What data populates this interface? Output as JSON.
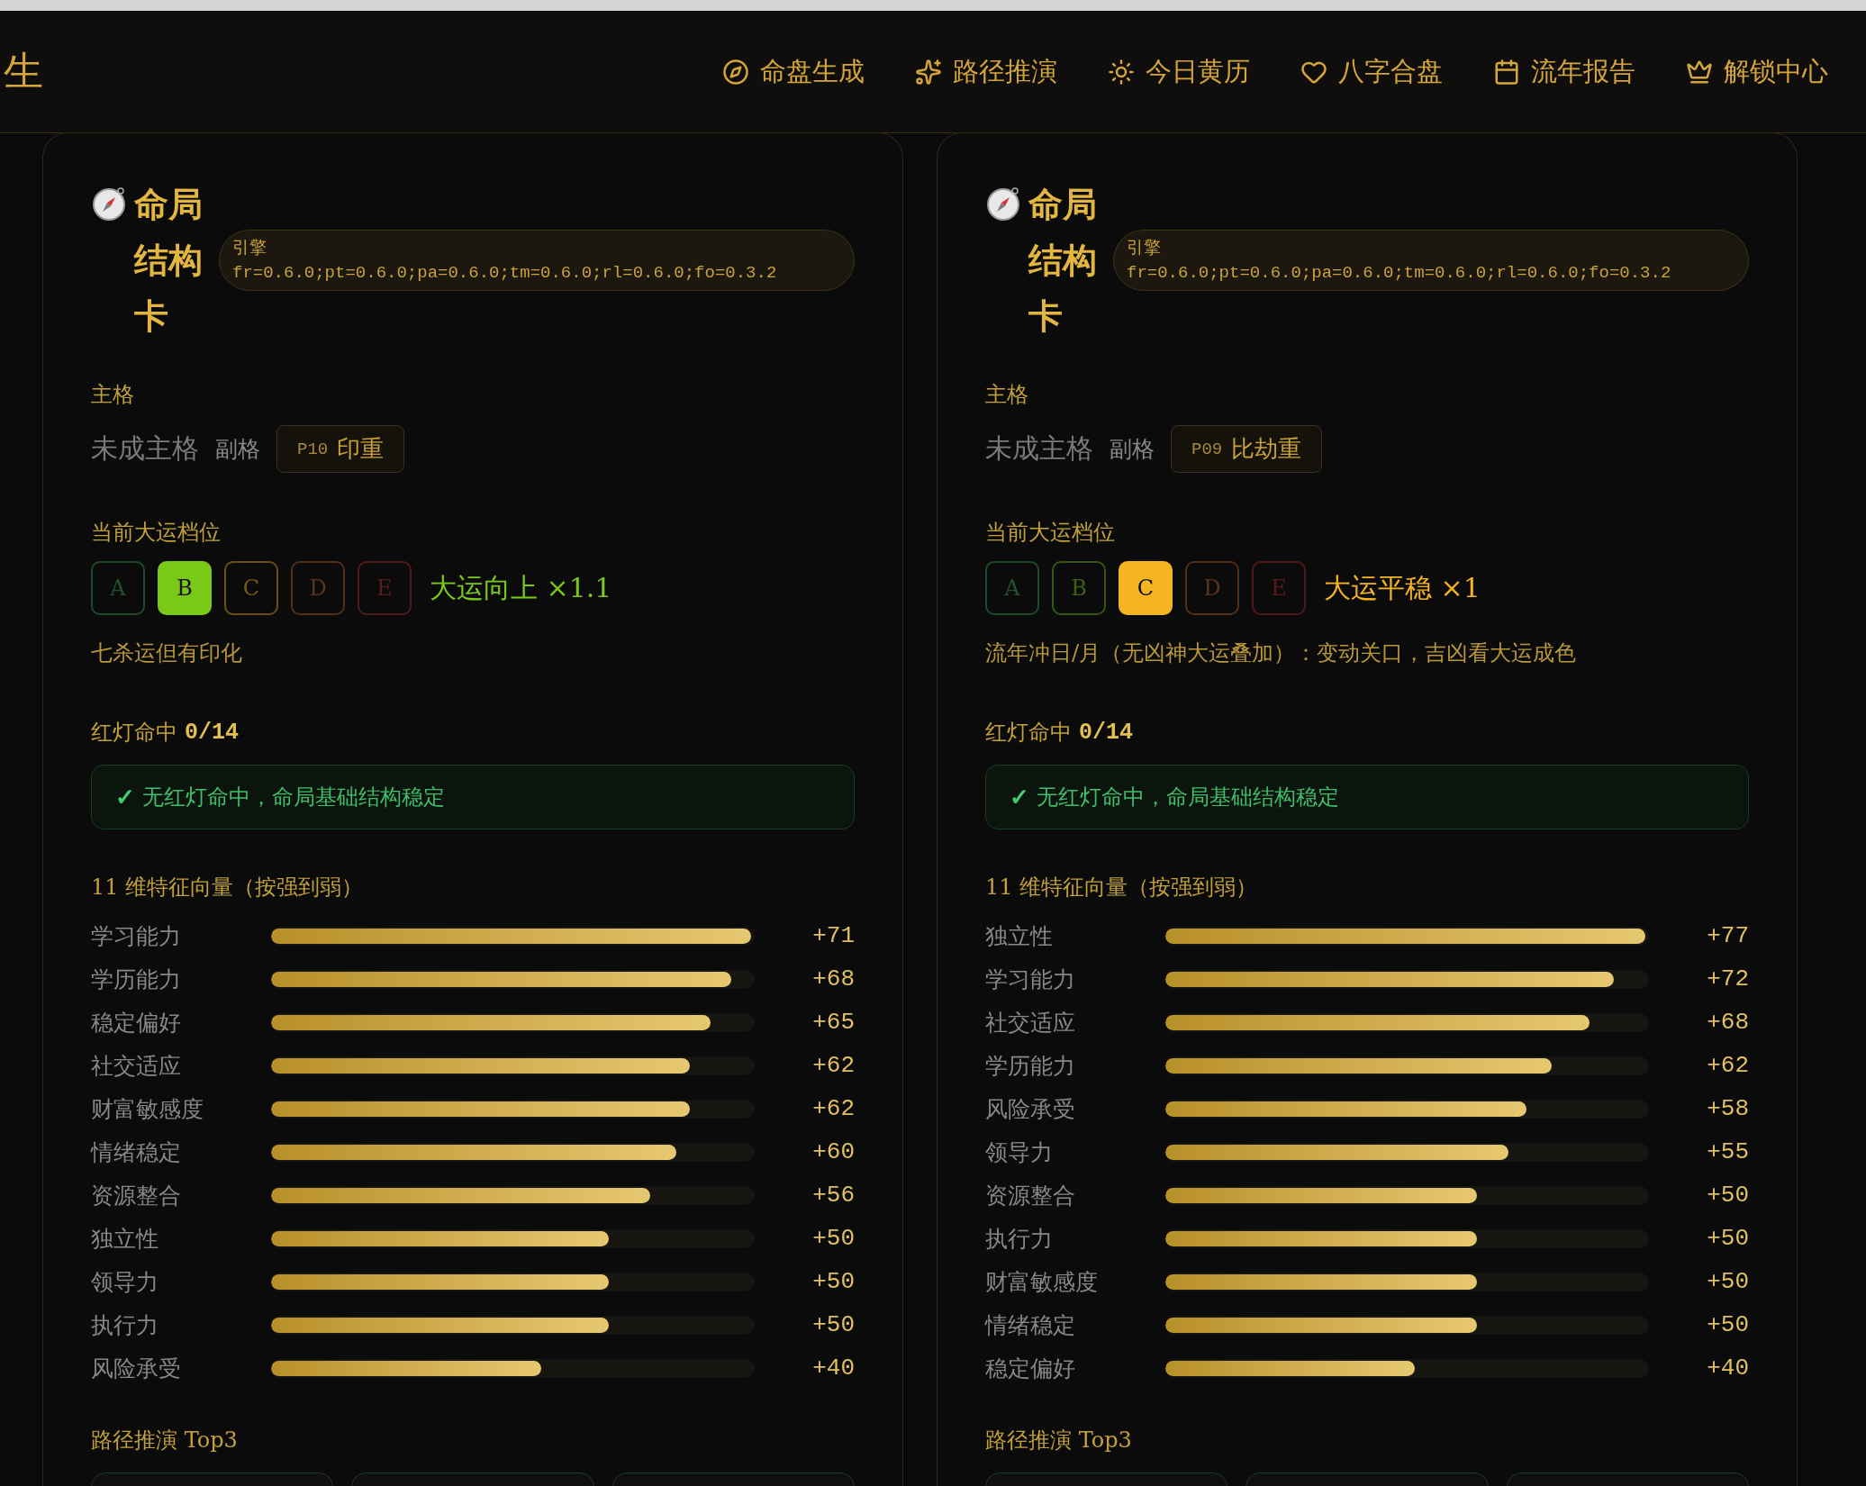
{
  "top_nav": {
    "logo": "生",
    "items": [
      {
        "label": "命盘生成"
      },
      {
        "label": "路径推演"
      },
      {
        "label": "今日黄历"
      },
      {
        "label": "八字合盘"
      },
      {
        "label": "流年报告"
      },
      {
        "label": "解锁中心"
      }
    ]
  },
  "cards": [
    {
      "title": "命局结构卡",
      "engine": {
        "label": "引擎",
        "value": "fr=0.6.0;pt=0.6.0;pa=0.6.0;tm=0.6.0;rl=0.6.0;fo=0.3.2"
      },
      "main_pattern": {
        "label": "主格",
        "value": "未成主格",
        "secondary_label": "副格",
        "tag_code": "P10",
        "tag_name": "印重"
      },
      "luck": {
        "label": "当前大运档位",
        "grades": [
          {
            "label": "A",
            "selected": false
          },
          {
            "label": "B",
            "selected": true
          },
          {
            "label": "C",
            "selected": false
          },
          {
            "label": "D",
            "selected": false
          },
          {
            "label": "E",
            "selected": false
          }
        ],
        "result": "大运向上 ×1.1",
        "note": "七杀运但有印化"
      },
      "red_light": {
        "label": "红灯命中",
        "count": "0/14",
        "mark": "✓",
        "message": "无红灯命中，命局基础结构稳定"
      },
      "vectors": {
        "title": "11 维特征向量（按强到弱）",
        "rows": [
          {
            "name": "学习能力",
            "level": 1,
            "value": "+71"
          },
          {
            "name": "学历能力",
            "level": 0.958,
            "value": "+68"
          },
          {
            "name": "稳定偏好",
            "level": 0.915,
            "value": "+65"
          },
          {
            "name": "社交适应",
            "level": 0.873,
            "value": "+62"
          },
          {
            "name": "财富敏感度",
            "level": 0.873,
            "value": "+62"
          },
          {
            "name": "情绪稳定",
            "level": 0.845,
            "value": "+60"
          },
          {
            "name": "资源整合",
            "level": 0.789,
            "value": "+56"
          },
          {
            "name": "独立性",
            "level": 0.704,
            "value": "+50"
          },
          {
            "name": "领导力",
            "level": 0.704,
            "value": "+50"
          },
          {
            "name": "执行力",
            "level": 0.704,
            "value": "+50"
          },
          {
            "name": "风险承受",
            "level": 0.563,
            "value": "+40"
          }
        ]
      },
      "routes": {
        "title": "路径推演 Top3"
      }
    },
    {
      "title": "命局结构卡",
      "engine": {
        "label": "引擎",
        "value": "fr=0.6.0;pt=0.6.0;pa=0.6.0;tm=0.6.0;rl=0.6.0;fo=0.3.2"
      },
      "main_pattern": {
        "label": "主格",
        "value": "未成主格",
        "secondary_label": "副格",
        "tag_code": "P09",
        "tag_name": "比劫重"
      },
      "luck": {
        "label": "当前大运档位",
        "grades": [
          {
            "label": "A",
            "selected": false
          },
          {
            "label": "B",
            "selected": false
          },
          {
            "label": "C",
            "selected": true
          },
          {
            "label": "D",
            "selected": false
          },
          {
            "label": "E",
            "selected": false
          }
        ],
        "result": "大运平稳 ×1",
        "note": "流年冲日/月（无凶神大运叠加）：变动关口，吉凶看大运成色"
      },
      "red_light": {
        "label": "红灯命中",
        "count": "0/14",
        "mark": "✓",
        "message": "无红灯命中，命局基础结构稳定"
      },
      "vectors": {
        "title": "11 维特征向量（按强到弱）",
        "rows": [
          {
            "name": "独立性",
            "level": 1,
            "value": "+77"
          },
          {
            "name": "学习能力",
            "level": 0.935,
            "value": "+72"
          },
          {
            "name": "社交适应",
            "level": 0.883,
            "value": "+68"
          },
          {
            "name": "学历能力",
            "level": 0.805,
            "value": "+62"
          },
          {
            "name": "风险承受",
            "level": 0.753,
            "value": "+58"
          },
          {
            "name": "领导力",
            "level": 0.714,
            "value": "+55"
          },
          {
            "name": "资源整合",
            "level": 0.649,
            "value": "+50"
          },
          {
            "name": "执行力",
            "level": 0.649,
            "value": "+50"
          },
          {
            "name": "财富敏感度",
            "level": 0.649,
            "value": "+50"
          },
          {
            "name": "情绪稳定",
            "level": 0.649,
            "value": "+50"
          },
          {
            "name": "稳定偏好",
            "level": 0.519,
            "value": "+40"
          }
        ]
      },
      "routes": {
        "title": "路径推演 Top3"
      }
    }
  ]
}
